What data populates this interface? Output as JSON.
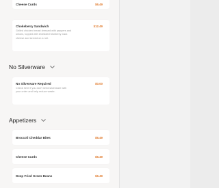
{
  "menu": {
    "top_item": {
      "name": "Cheese Curds",
      "price": "$6.49"
    },
    "featured_item": {
      "name": "Chokeberry Sandwich",
      "price": "$12.49",
      "description_lines": [
        "Grilled chicken breast dressed with peppers and",
        "onions, topped with shredded Monterey Jack",
        "cheese and served on a roll."
      ]
    },
    "silverware_section": {
      "title": "No Silverware",
      "item": {
        "name": "No Silverware Required",
        "price": "$0.00",
        "description_lines": [
          "Check here if you don't need silverware with",
          "your order and help reduce waste."
        ]
      }
    },
    "appetizers_section": {
      "title": "Appetizers",
      "items": [
        {
          "name": "Broccoli Cheddar Bites",
          "price": "$6.49"
        },
        {
          "name": "Cheese Curds",
          "price": "$6.49"
        },
        {
          "name": "Deep Fried Green Beans",
          "price": "$6.49"
        }
      ]
    }
  },
  "colors": {
    "price": "#e07a2c",
    "panel_bg": "#f7f6f5",
    "card_bg": "#ffffff"
  }
}
